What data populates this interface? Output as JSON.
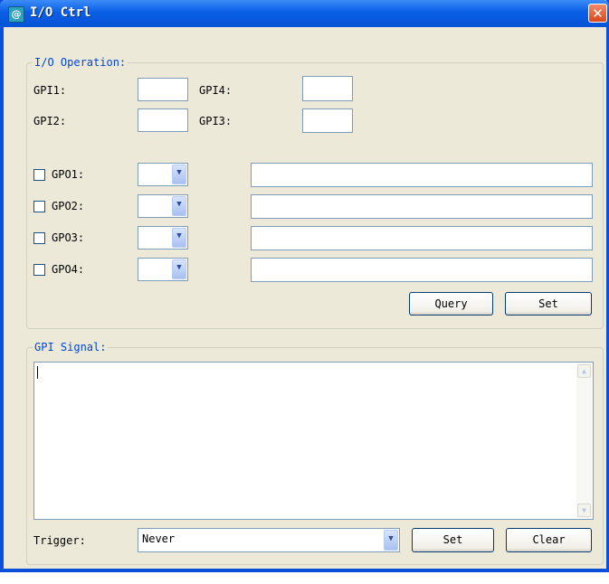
{
  "window": {
    "title": "I/O Ctrl",
    "close_glyph": "✕",
    "icon": "app-icon"
  },
  "io_operation": {
    "legend": "I/O Operation:",
    "gpi": [
      {
        "label": "GPI1:",
        "value": ""
      },
      {
        "label": "GPI4:",
        "value": ""
      },
      {
        "label": "GPI2:",
        "value": ""
      },
      {
        "label": "GPI3:",
        "value": ""
      }
    ],
    "gpo": [
      {
        "label": "GPO1:",
        "checked": false,
        "selected": "",
        "text": ""
      },
      {
        "label": "GPO2:",
        "checked": false,
        "selected": "",
        "text": ""
      },
      {
        "label": "GPO3:",
        "checked": false,
        "selected": "",
        "text": ""
      },
      {
        "label": "GPO4:",
        "checked": false,
        "selected": "",
        "text": ""
      }
    ],
    "query_label": "Query",
    "set_label": "Set"
  },
  "gpi_signal": {
    "legend": "GPI Signal:",
    "log_text": "",
    "trigger_label": "Trigger:",
    "trigger_value": "Never",
    "set_label": "Set",
    "clear_label": "Clear"
  },
  "icons": {
    "dropdown": "chevron-down-icon",
    "scroll_up": "scroll-up-icon",
    "scroll_down": "scroll-down-icon"
  }
}
